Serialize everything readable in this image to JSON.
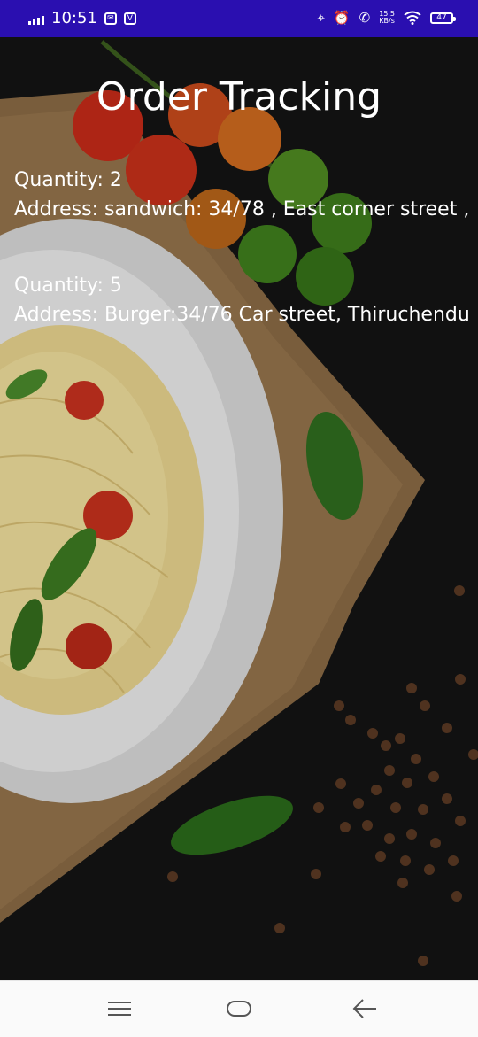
{
  "status_bar": {
    "time": "10:51",
    "network_speed_value": "15.5",
    "network_speed_unit": "KB/s",
    "battery_level": "47",
    "background_color": "#2a0fb0"
  },
  "page": {
    "title": "Order Tracking"
  },
  "orders": [
    {
      "quantity": "Quantity: 2",
      "address": "Address: sandwich: 34/78 , East corner street ,"
    },
    {
      "quantity": "Quantity: 5",
      "address": "Address: Burger:34/76 Car street, Thiruchendu"
    }
  ],
  "nav_bar": {
    "icons": [
      "menu-icon",
      "home-icon",
      "back-icon"
    ]
  }
}
